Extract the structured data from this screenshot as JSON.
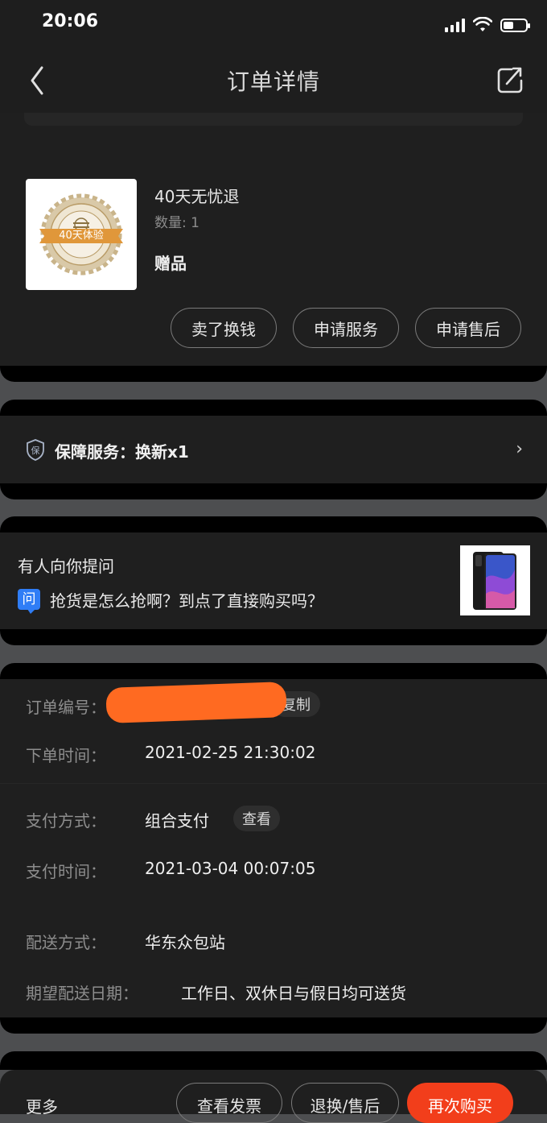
{
  "status_bar": {
    "time": "20:06"
  },
  "header": {
    "title": "订单详情"
  },
  "product": {
    "badge_text": "40天体验",
    "badge_ring_text": "EXTENDED WARRANTY",
    "name": "40天无忧退",
    "quantity": "数量: 1",
    "tag": "赠品",
    "actions": [
      "卖了换钱",
      "申请服务",
      "申请售后"
    ]
  },
  "guarantee": {
    "icon_char": "保",
    "label": "保障服务：换新x1",
    "chevron": "›"
  },
  "question": {
    "title": "有人向你提问",
    "badge": "问",
    "text": "抢货是怎么抢啊？到点了直接购买吗？"
  },
  "order_info": {
    "order_no_label": "订单编号：",
    "copy_label": "复制",
    "order_time_label": "下单时间：",
    "order_time": "2021-02-25 21:30:02",
    "pay_method_label": "支付方式：",
    "pay_method": "组合支付",
    "view_label": "查看",
    "pay_time_label": "支付时间：",
    "pay_time": "2021-03-04 00:07:05",
    "delivery_label": "配送方式：",
    "delivery": "华东众包站",
    "expected_label": "期望配送日期：",
    "expected": "工作日、双休日与假日均可送货"
  },
  "bottom_bar": {
    "more": "更多",
    "invoice": "查看发票",
    "return": "退换/售后",
    "rebuy": "再次购买"
  },
  "colors": {
    "accent": "#f23e1b",
    "badge_blue": "#2f7df6",
    "gold": "#e0973a"
  }
}
